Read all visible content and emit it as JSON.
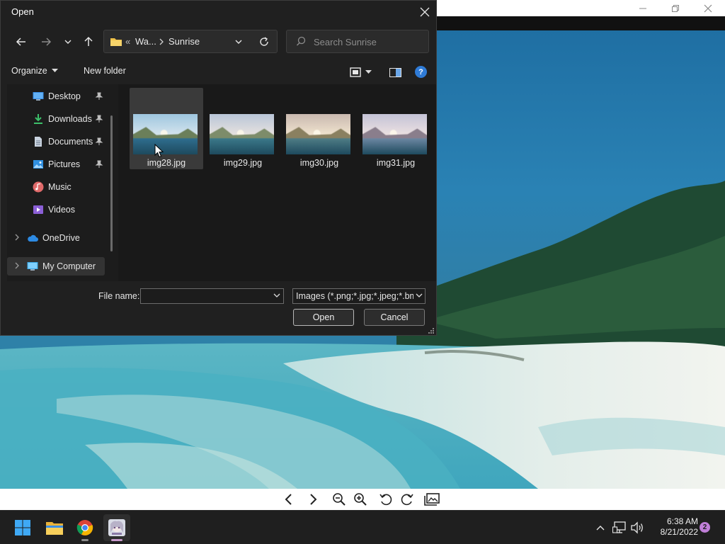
{
  "viewer": {
    "window_controls": [
      "minimize",
      "maximize",
      "close"
    ],
    "toolbar_icons": [
      "previous-icon",
      "next-icon",
      "zoom-out-icon",
      "zoom-in-icon",
      "rotate-left-icon",
      "rotate-right-icon",
      "gallery-icon"
    ]
  },
  "dialog": {
    "title": "Open",
    "address": {
      "overflow": "«",
      "crumbs": [
        "Wa...",
        "Sunrise"
      ]
    },
    "search": {
      "placeholder": "Search Sunrise",
      "value": ""
    },
    "commands": {
      "organize": "Organize",
      "new_folder": "New folder",
      "help": "?"
    },
    "nav": {
      "quick_access": [
        {
          "label": "Desktop",
          "icon": "desktop-icon",
          "pinned": true
        },
        {
          "label": "Downloads",
          "icon": "download-icon",
          "pinned": true
        },
        {
          "label": "Documents",
          "icon": "document-icon",
          "pinned": true
        },
        {
          "label": "Pictures",
          "icon": "pictures-icon",
          "pinned": true
        },
        {
          "label": "Music",
          "icon": "music-icon",
          "pinned": false
        },
        {
          "label": "Videos",
          "icon": "videos-icon",
          "pinned": false
        }
      ],
      "onedrive": "OneDrive",
      "my_computer": "My Computer"
    },
    "files": [
      {
        "name": "img28.jpg",
        "selected": true
      },
      {
        "name": "img29.jpg",
        "selected": false
      },
      {
        "name": "img30.jpg",
        "selected": false
      },
      {
        "name": "img31.jpg",
        "selected": false
      }
    ],
    "footer": {
      "file_name_label": "File name:",
      "file_name_value": "",
      "filter": "Images (*.png;*.jpg;*.jpeg;*.bm",
      "open": "Open",
      "cancel": "Cancel"
    }
  },
  "taskbar": {
    "apps": [
      "start-icon",
      "file-explorer-icon",
      "chrome-icon",
      "image-viewer-icon"
    ],
    "active_app": "image-viewer-icon",
    "time": "6:38 AM",
    "date": "8/21/2022",
    "notifications": "2"
  },
  "colors": {
    "dialog_bg": "#202020",
    "accent": "#2f7bd6",
    "selected_item": "#3a3a3a",
    "notification_badge": "#c07fd8"
  }
}
